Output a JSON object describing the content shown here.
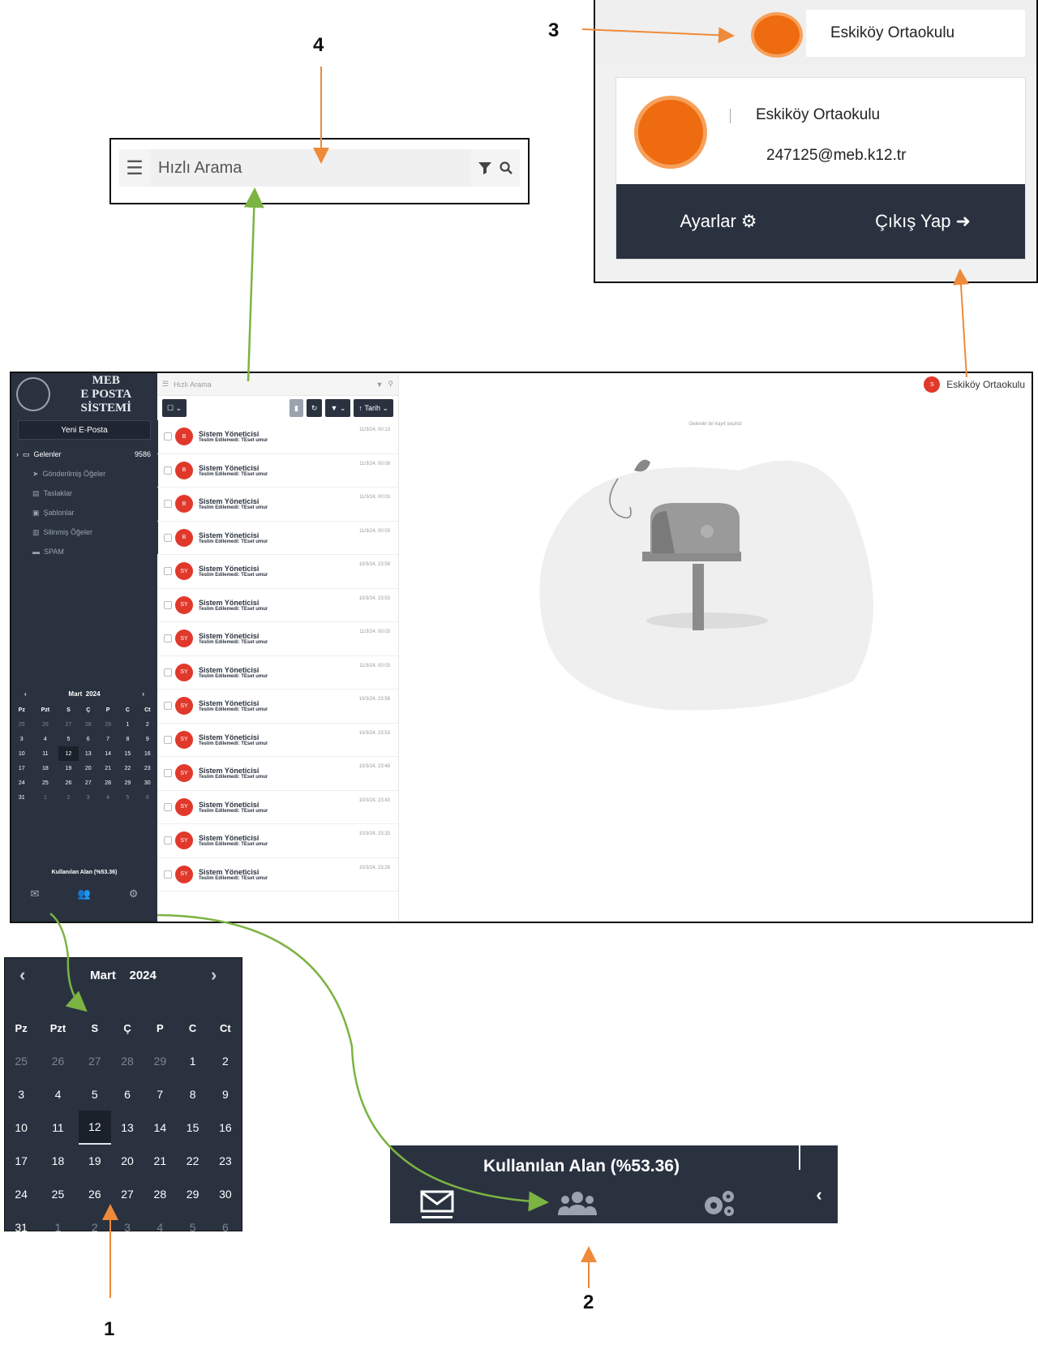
{
  "callouts": {
    "n1": "1",
    "n2": "2",
    "n3": "3",
    "n4": "4"
  },
  "search": {
    "placeholder": "Hızlı Arama"
  },
  "profile": {
    "name": "Eskiköy Ortaokulu",
    "email": "247125@meb.k12.tr",
    "settings_label": "Ayarlar",
    "logout_label": "Çıkış Yap"
  },
  "sidebar": {
    "logo_line1": "MEB",
    "logo_line2": "E POSTA SİSTEMİ",
    "new_mail": "Yeni E-Posta",
    "folders": [
      {
        "label": "Gelenler",
        "count": "9586"
      },
      {
        "label": "Gönderilmiş Öğeler"
      },
      {
        "label": "Taslaklar"
      },
      {
        "label": "Şablonlar"
      },
      {
        "label": "Silinmiş Öğeler"
      },
      {
        "label": "SPAM"
      }
    ],
    "usage": "Kullanılan Alan (%53.36)"
  },
  "calendar": {
    "month": "Mart",
    "year": "2024",
    "weekdays": [
      "Pz",
      "Pzt",
      "S",
      "Ç",
      "P",
      "C",
      "Ct"
    ],
    "weeks": [
      [
        "25",
        "26",
        "27",
        "28",
        "29",
        "1",
        "2"
      ],
      [
        "3",
        "4",
        "5",
        "6",
        "7",
        "8",
        "9"
      ],
      [
        "10",
        "11",
        "12",
        "13",
        "14",
        "15",
        "16"
      ],
      [
        "17",
        "18",
        "19",
        "20",
        "21",
        "22",
        "23"
      ],
      [
        "24",
        "25",
        "26",
        "27",
        "28",
        "29",
        "30"
      ],
      [
        "31",
        "1",
        "2",
        "3",
        "4",
        "5",
        "6"
      ]
    ],
    "today": "12"
  },
  "toolbar": {
    "sort_label": "Tarih"
  },
  "mails": [
    {
      "avatar": "B",
      "sender": "Sistem Yöneticisi",
      "subject": "Teslim Edilemedi: TEset umur",
      "date": "11/3/24, 00:13"
    },
    {
      "avatar": "B",
      "sender": "Sistem Yöneticisi",
      "subject": "Teslim Edilemedi: TEset umur",
      "date": "11/3/24, 00:08"
    },
    {
      "avatar": "B",
      "sender": "Sistem Yöneticisi",
      "subject": "Teslim Edilemedi: TEset umur",
      "date": "11/3/24, 00:03"
    },
    {
      "avatar": "B",
      "sender": "Sistem Yöneticisi",
      "subject": "Teslim Edilemedi: TEset umur",
      "date": "11/3/24, 00:03"
    },
    {
      "avatar": "SY",
      "sender": "Sistem Yöneticisi",
      "subject": "Teslim Edilemedi: TEset umur",
      "date": "10/3/24, 23:58"
    },
    {
      "avatar": "SY",
      "sender": "Sistem Yöneticisi",
      "subject": "Teslim Edilemedi: TEset umur",
      "date": "10/3/24, 23:53"
    },
    {
      "avatar": "SY",
      "sender": "Sistem Yöneticisi",
      "subject": "Teslim Edilemedi: TEset umur",
      "date": "11/3/24, 00:03"
    },
    {
      "avatar": "SY",
      "sender": "Sistem Yöneticisi",
      "subject": "Teslim Edilemedi: TEset umur",
      "date": "11/3/24, 00:03"
    },
    {
      "avatar": "SY",
      "sender": "Sistem Yöneticisi",
      "subject": "Teslim Edilemedi: TEset umur",
      "date": "10/3/24, 23:58"
    },
    {
      "avatar": "SY",
      "sender": "Sistem Yöneticisi",
      "subject": "Teslim Edilemedi: TEset umur",
      "date": "10/3/24, 23:53"
    },
    {
      "avatar": "SY",
      "sender": "Sistem Yöneticisi",
      "subject": "Teslim Edilemedi: TEset umur",
      "date": "10/3/24, 23:48"
    },
    {
      "avatar": "SY",
      "sender": "Sistem Yöneticisi",
      "subject": "Teslim Edilemedi: TEset umur",
      "date": "10/3/24, 23:43"
    },
    {
      "avatar": "SY",
      "sender": "Sistem Yöneticisi",
      "subject": "Teslim Edilemedi: TEset umur",
      "date": "10/3/24, 23:33"
    },
    {
      "avatar": "SY",
      "sender": "Sistem Yöneticisi",
      "subject": "Teslim Edilemedi: TEset umur",
      "date": "10/3/24, 23:28"
    }
  ],
  "reading": {
    "hint": "Gelenler bir kayıt seçiniz",
    "user_initial": "S",
    "user_name": "Eskiköy Ortaokulu"
  },
  "colors": {
    "navy": "#2a3240",
    "orange": "#ee6b0f",
    "green_arrow": "#7cb342",
    "orange_arrow": "#ee8a3a",
    "avatar_red": "#e0392b"
  }
}
